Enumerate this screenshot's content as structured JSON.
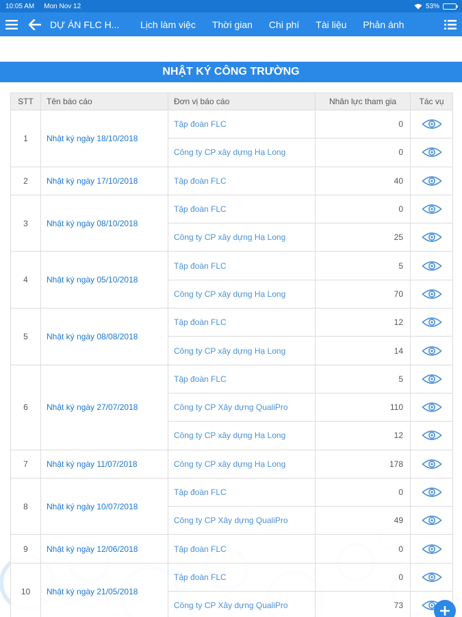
{
  "status": {
    "time": "10:05 AM",
    "date": "Mon Nov 12",
    "battery": "53%",
    "battery_level": 0.53
  },
  "nav": {
    "title": "DỰ ÁN FLC H...",
    "items": [
      "Lịch làm việc",
      "Thời gian",
      "Chi phí",
      "Tài liệu",
      "Phản ánh"
    ]
  },
  "page_title": "NHẬT KÝ CÔNG TRƯỜNG",
  "table": {
    "headers": {
      "stt": "STT",
      "name": "Tên báo cáo",
      "unit": "Đơn vị báo cáo",
      "count": "Nhân lực tham gia",
      "action": "Tác vụ"
    },
    "groups": [
      {
        "stt": "1",
        "name": "Nhật ký ngày 18/10/2018",
        "rows": [
          {
            "unit": "Tập đoàn FLC",
            "count": "0"
          },
          {
            "unit": "Công ty CP xây dựng Hạ Long",
            "count": "0"
          }
        ]
      },
      {
        "stt": "2",
        "name": "Nhật ký ngày 17/10/2018",
        "rows": [
          {
            "unit": "Tập đoàn FLC",
            "count": "40"
          }
        ]
      },
      {
        "stt": "3",
        "name": "Nhật ký ngày 08/10/2018",
        "rows": [
          {
            "unit": "Tập đoàn FLC",
            "count": "0"
          },
          {
            "unit": "Công ty CP xây dựng Hạ Long",
            "count": "25"
          }
        ]
      },
      {
        "stt": "4",
        "name": "Nhật ký ngày 05/10/2018",
        "rows": [
          {
            "unit": "Tập đoàn FLC",
            "count": "5"
          },
          {
            "unit": "Công ty CP xây dựng Hạ Long",
            "count": "70"
          }
        ]
      },
      {
        "stt": "5",
        "name": "Nhật ký ngày 08/08/2018",
        "rows": [
          {
            "unit": "Tập đoàn FLC",
            "count": "12"
          },
          {
            "unit": "Công ty CP xây dựng Hạ Long",
            "count": "14"
          }
        ]
      },
      {
        "stt": "6",
        "name": "Nhật ký ngày 27/07/2018",
        "rows": [
          {
            "unit": "Tập đoàn FLC",
            "count": "5"
          },
          {
            "unit": "Công ty CP Xây dựng QualiPro",
            "count": "110"
          },
          {
            "unit": "Công ty CP xây dựng Hạ Long",
            "count": "12"
          }
        ]
      },
      {
        "stt": "7",
        "name": "Nhật ký ngày 11/07/2018",
        "rows": [
          {
            "unit": "Công ty CP xây dựng Hạ Long",
            "count": "178"
          }
        ]
      },
      {
        "stt": "8",
        "name": "Nhật ký ngày 10/07/2018",
        "rows": [
          {
            "unit": "Tập đoàn FLC",
            "count": "0"
          },
          {
            "unit": "Công ty CP Xây dựng QualiPro",
            "count": "49"
          }
        ]
      },
      {
        "stt": "9",
        "name": "Nhật ký ngày 12/06/2018",
        "rows": [
          {
            "unit": "Tập đoàn FLC",
            "count": "0"
          }
        ]
      },
      {
        "stt": "10",
        "name": "Nhật ký ngày 21/05/2018",
        "rows": [
          {
            "unit": "Tập đoàn FLC",
            "count": "0"
          },
          {
            "unit": "Công ty CP Xây dựng QualiPro",
            "count": "73"
          }
        ]
      }
    ]
  },
  "icons": {
    "menu": "hamburger-icon",
    "back": "back-arrow-icon",
    "more": "list-menu-icon",
    "view": "eye-icon",
    "add": "plus-icon"
  },
  "colors": {
    "primary": "#2a88e6",
    "status_bar": "#1976d2",
    "link": "#1976d2"
  }
}
